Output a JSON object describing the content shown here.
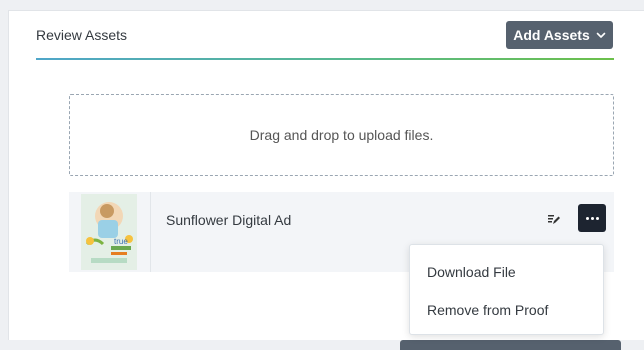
{
  "header": {
    "title": "Review Assets",
    "add_assets_label": "Add Assets"
  },
  "dropzone": {
    "text": "Drag and drop to upload files."
  },
  "asset": {
    "name": "Sunflower Digital Ad",
    "thumbnail_text": "true"
  },
  "menu": {
    "items": [
      "Download File",
      "Remove from Proof"
    ]
  },
  "colors": {
    "button_bg": "#56616e",
    "more_button_bg": "#1d2430",
    "divider_start": "#4fa6c9",
    "divider_end": "#6cc04a"
  },
  "icons": {
    "add_assets": "chevron-down-icon",
    "row_action": "edit-icon",
    "more": "more-options-icon"
  }
}
